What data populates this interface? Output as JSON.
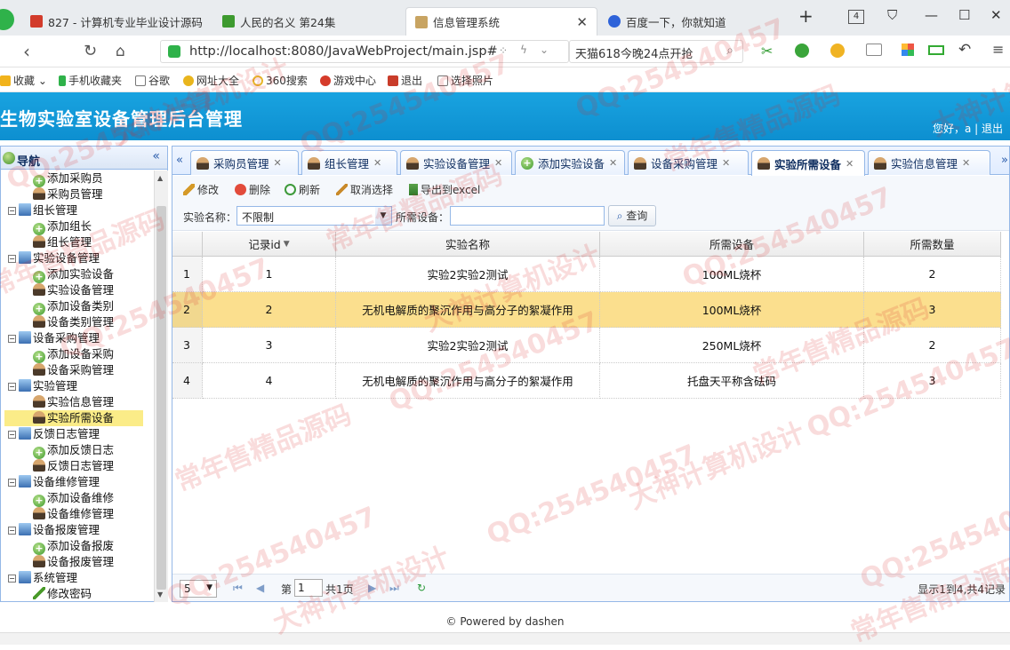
{
  "browser": {
    "tabs": [
      {
        "label": "827 - 计算机专业毕业设计源码"
      },
      {
        "label": "人民的名义 第24集"
      },
      {
        "label": "信息管理系统"
      },
      {
        "label": "百度一下，你就知道"
      }
    ],
    "tab_count": "4",
    "url": "http://localhost:8080/JavaWebProject/main.jsp#",
    "search_text": "天猫618今晚24点开抢"
  },
  "bookmarks": [
    "收藏",
    "手机收藏夹",
    "谷歌",
    "网址大全",
    "360搜索",
    "游戏中心",
    "退出",
    "选择照片"
  ],
  "app": {
    "title": "生物实验室设备管理后台管理",
    "welcome": "您好，a | 退出"
  },
  "nav": {
    "title": "导航",
    "items": [
      {
        "label": "添加采购员",
        "type": "add"
      },
      {
        "label": "采购员管理",
        "type": "user"
      },
      {
        "label": "组长管理",
        "type": "group"
      },
      {
        "label": "添加组长",
        "type": "add"
      },
      {
        "label": "组长管理",
        "type": "user"
      },
      {
        "label": "实验设备管理",
        "type": "group"
      },
      {
        "label": "添加实验设备",
        "type": "add"
      },
      {
        "label": "实验设备管理",
        "type": "user"
      },
      {
        "label": "添加设备类别",
        "type": "add"
      },
      {
        "label": "设备类别管理",
        "type": "user"
      },
      {
        "label": "设备采购管理",
        "type": "group"
      },
      {
        "label": "添加设备采购",
        "type": "add"
      },
      {
        "label": "设备采购管理",
        "type": "user"
      },
      {
        "label": "实验管理",
        "type": "group"
      },
      {
        "label": "实验信息管理",
        "type": "user"
      },
      {
        "label": "实验所需设备",
        "type": "user",
        "selected": true
      },
      {
        "label": "反馈日志管理",
        "type": "group"
      },
      {
        "label": "添加反馈日志",
        "type": "add"
      },
      {
        "label": "反馈日志管理",
        "type": "user"
      },
      {
        "label": "设备维修管理",
        "type": "group"
      },
      {
        "label": "添加设备维修",
        "type": "add"
      },
      {
        "label": "设备维修管理",
        "type": "user"
      },
      {
        "label": "设备报废管理",
        "type": "group"
      },
      {
        "label": "添加设备报废",
        "type": "add"
      },
      {
        "label": "设备报废管理",
        "type": "user"
      },
      {
        "label": "系统管理",
        "type": "group"
      },
      {
        "label": "修改密码",
        "type": "pen"
      }
    ]
  },
  "panel_tabs": [
    {
      "label": "采购员管理",
      "icon": "user"
    },
    {
      "label": "组长管理",
      "icon": "user"
    },
    {
      "label": "实验设备管理",
      "icon": "user"
    },
    {
      "label": "添加实验设备",
      "icon": "add"
    },
    {
      "label": "设备采购管理",
      "icon": "user"
    },
    {
      "label": "实验所需设备",
      "icon": "user",
      "active": true
    },
    {
      "label": "实验信息管理",
      "icon": "user"
    }
  ],
  "toolbar": {
    "edit": "修改",
    "delete": "删除",
    "refresh": "刷新",
    "unselect": "取消选择",
    "export": "导出到excel"
  },
  "filter": {
    "exp_label": "实验名称：",
    "exp_value": "不限制",
    "device_label": "所需设备：",
    "device_value": "",
    "query": "查询"
  },
  "grid": {
    "columns": [
      "记录id",
      "实验名称",
      "所需设备",
      "所需数量"
    ],
    "rows": [
      {
        "rn": "1",
        "id": "1",
        "name": "实验2实验2测试",
        "device": "100ML烧杯",
        "qty": "2"
      },
      {
        "rn": "2",
        "id": "2",
        "name": "无机电解质的聚沉作用与高分子的絮凝作用",
        "device": "100ML烧杯",
        "qty": "3",
        "selected": true
      },
      {
        "rn": "3",
        "id": "3",
        "name": "实验2实验2测试",
        "device": "250ML烧杯",
        "qty": "2"
      },
      {
        "rn": "4",
        "id": "4",
        "name": "无机电解质的聚沉作用与高分子的絮凝作用",
        "device": "托盘天平称含砝码",
        "qty": "3"
      }
    ]
  },
  "pager": {
    "page_size": "5",
    "page_prefix": "第",
    "page_num": "1",
    "page_total": "共1页",
    "summary": "显示1到4,共4记录"
  },
  "footer": "© Powered by dashen",
  "watermarks": [
    "QQ:254540457",
    "常年售精品源码",
    "大神计算机设计"
  ],
  "colors": {
    "header_blue": "#12a0dd",
    "selected_row": "#fbdf8e",
    "border_blue": "#95b8e7"
  }
}
